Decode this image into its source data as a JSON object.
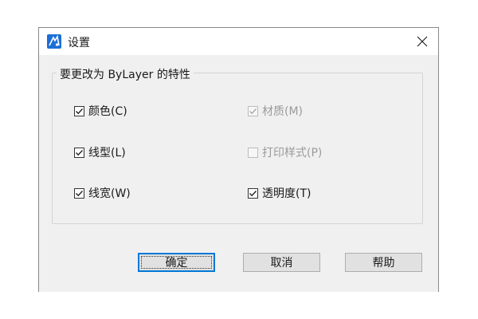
{
  "window": {
    "title": "设置",
    "close_icon": "close-icon",
    "app_icon": "cad-app-icon"
  },
  "group": {
    "legend": "要更改为 ByLayer 的特性"
  },
  "options": {
    "color": {
      "label": "颜色(C)",
      "checked": true,
      "enabled": true
    },
    "material": {
      "label": "材质(M)",
      "checked": true,
      "enabled": false
    },
    "linetype": {
      "label": "线型(L)",
      "checked": true,
      "enabled": true
    },
    "plotstyle": {
      "label": "打印样式(P)",
      "checked": false,
      "enabled": false
    },
    "lineweight": {
      "label": "线宽(W)",
      "checked": true,
      "enabled": true
    },
    "transparency": {
      "label": "透明度(T)",
      "checked": true,
      "enabled": true
    }
  },
  "buttons": {
    "ok": "确定",
    "cancel": "取消",
    "help": "帮助"
  },
  "colors": {
    "accent": "#0078d7",
    "dialog_bg": "#f0f0f0"
  }
}
